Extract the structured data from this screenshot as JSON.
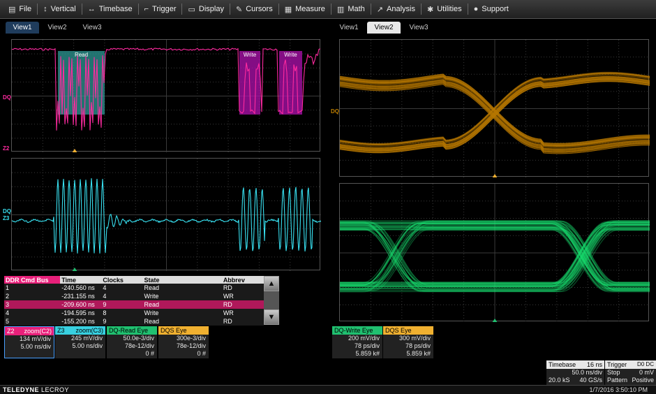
{
  "menu": [
    {
      "icon": "file-icon",
      "glyph": "▤",
      "label": "File"
    },
    {
      "icon": "vertical-icon",
      "glyph": "↕",
      "label": "Vertical"
    },
    {
      "icon": "timebase-icon",
      "glyph": "↔",
      "label": "Timebase"
    },
    {
      "icon": "trigger-icon",
      "glyph": "⌐",
      "label": "Trigger"
    },
    {
      "icon": "display-icon",
      "glyph": "▭",
      "label": "Display"
    },
    {
      "icon": "cursors-icon",
      "glyph": "✎",
      "label": "Cursors"
    },
    {
      "icon": "measure-icon",
      "glyph": "▦",
      "label": "Measure"
    },
    {
      "icon": "math-icon",
      "glyph": "▥",
      "label": "Math"
    },
    {
      "icon": "analysis-icon",
      "glyph": "↗",
      "label": "Analysis"
    },
    {
      "icon": "utilities-icon",
      "glyph": "✱",
      "label": "Utilities"
    },
    {
      "icon": "support-icon",
      "glyph": "●",
      "label": "Support"
    }
  ],
  "tabs_left": [
    "View1",
    "View2",
    "View3"
  ],
  "tabs_right": [
    "View1",
    "View2",
    "View3"
  ],
  "colors": {
    "magenta": "#ff2aa0",
    "cyan": "#38e0f0",
    "orange": "#b87800",
    "green": "#18e070",
    "read_box": "#2e9a96",
    "write_box": "#b012b0"
  },
  "waveform": {
    "read_label": "Read",
    "write_label_1": "Write",
    "write_label_2": "Write",
    "dq_label": "DQ",
    "z2_label": "Z2",
    "z3_label": "Z3",
    "dqs_label": "DQ"
  },
  "bus_table": {
    "headers": [
      "DDR Cmd Bus",
      "Time",
      "Clocks",
      "State",
      "Abbrev"
    ],
    "rows": [
      [
        "1",
        "-240.560 ns",
        "4",
        "Read",
        "RD"
      ],
      [
        "2",
        "-231.155 ns",
        "4",
        "Write",
        "WR"
      ],
      [
        "3",
        "-209.600 ns",
        "9",
        "Read",
        "RD"
      ],
      [
        "4",
        "-194.595 ns",
        "8",
        "Write",
        "WR"
      ],
      [
        "5",
        "-155.200 ns",
        "9",
        "Read",
        "RD"
      ]
    ],
    "selected_row": 2
  },
  "badges": [
    {
      "title": "Z2",
      "sub": "zoom(C2)",
      "l1": "134 mV/div",
      "l2": "5.00 ns/div",
      "l3": "",
      "color": "#e8207a"
    },
    {
      "title": "Z3",
      "sub": "zoom(C3)",
      "l1": "245 mV/div",
      "l2": "5.00 ns/div",
      "l3": "",
      "color": "#38d0e0"
    },
    {
      "title": "DQ-Read Eye",
      "sub": "",
      "l1": "50.0e-3/div",
      "l2": "78e-12/div",
      "l3": "0 #",
      "color": "#20c070"
    },
    {
      "title": "DQS Eye",
      "sub": "",
      "l1": "300e-3/div",
      "l2": "78e-12/div",
      "l3": "0 #",
      "color": "#f0b030"
    },
    {
      "title": "DQ-Write Eye",
      "sub": "",
      "l1": "200 mV/div",
      "l2": "78 ps/div",
      "l3": "5.859 k#",
      "color": "#20c070"
    },
    {
      "title": "DQS Eye",
      "sub": "",
      "l1": "300 mV/div",
      "l2": "78 ps/div",
      "l3": "5.859 k#",
      "color": "#f0b030"
    }
  ],
  "timebase": {
    "label": "Timebase",
    "value": "16 ns",
    "l1": "50.0 ns/div",
    "l2a": "20.0 kS",
    "l2b": "40 GS/s"
  },
  "trigger": {
    "label": "Trigger",
    "chips": "D0 DC",
    "l1a": "Stop",
    "l1b": "0 mV",
    "l2a": "Pattern",
    "l2b": "Positive"
  },
  "footer": {
    "brand_a": "TELEDYNE",
    "brand_b": " LECROY",
    "datetime": "1/7/2016 3:50:10 PM"
  }
}
